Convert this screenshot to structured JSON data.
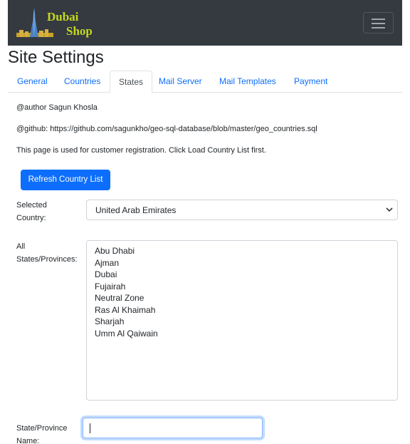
{
  "navbar": {
    "brand_line1": "Dubai",
    "brand_line2": "Shop",
    "bg_color": "#343a40",
    "brand_color": "#c6d81e",
    "toggler_icon": "hamburger-menu-icon"
  },
  "page_title": "Site Settings",
  "tabs": [
    {
      "label": "General",
      "active": false
    },
    {
      "label": "Countries",
      "active": false
    },
    {
      "label": "States",
      "active": true
    },
    {
      "label": "Mail Server",
      "active": false
    },
    {
      "label": "Mail Templates",
      "active": false
    },
    {
      "label": "Payment",
      "active": false
    }
  ],
  "info": {
    "author": "@author Sagun Khosla",
    "github": "@github: https://github.com/sagunkho/geo-sql-database/blob/master/geo_countries.sql",
    "description": "This page is used for customer registration. Click Load Country List first."
  },
  "refresh_button": "Refresh Country List",
  "selected_country": {
    "label_line1": "Selected",
    "label_line2": "Country:",
    "value": "United Arab Emirates"
  },
  "states": {
    "label_line1": "All",
    "label_line2": "States/Provinces:",
    "items": [
      "Abu Dhabi",
      "Ajman",
      "Dubai",
      "Fujairah",
      "Neutral Zone",
      "Ras Al Khaimah",
      "Sharjah",
      "Umm Al Qaiwain"
    ]
  },
  "state_name": {
    "label_line1": "State/Province",
    "label_line2": "Name:",
    "value": ""
  },
  "colors": {
    "primary": "#0d6efd",
    "link": "#0d6efd"
  }
}
